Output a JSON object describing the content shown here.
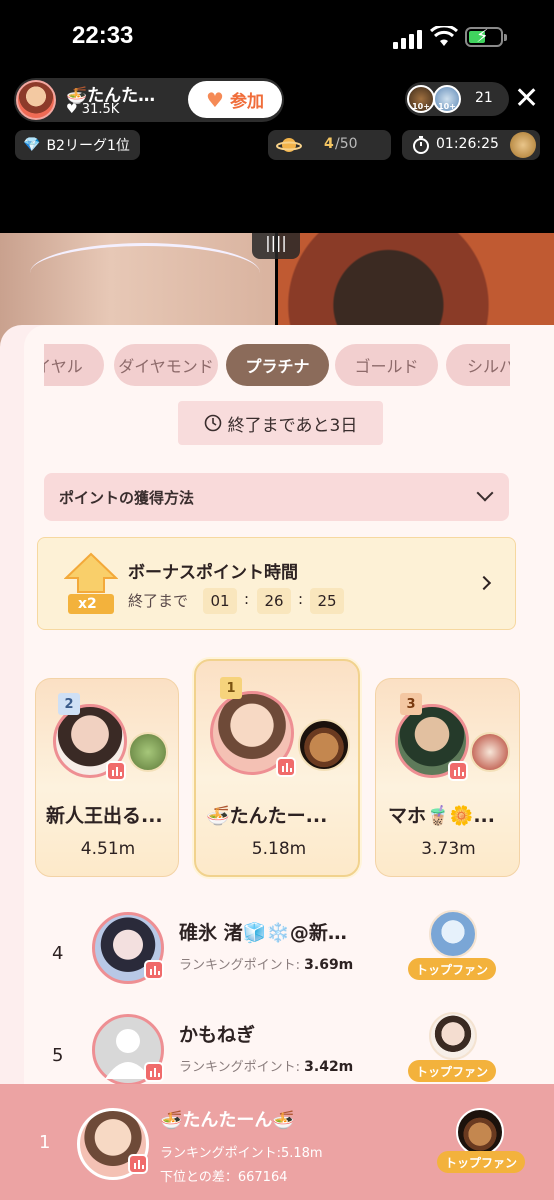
{
  "status_bar": {
    "time": "22:33"
  },
  "stream": {
    "host_name": "🍜たんた…",
    "host_likes": "31.5K",
    "join_label": "参加",
    "viewer_badges": [
      "10+",
      "10+"
    ],
    "viewer_count": "21",
    "league_label": "B2リーグ1位",
    "planet_progress_current": "4",
    "planet_progress_total": "/50",
    "session_timer": "01:26:25"
  },
  "ranking": {
    "tabs": [
      "イヤル",
      "ダイヤモンド",
      "プラチナ",
      "ゴールド",
      "シルバ"
    ],
    "active_tab": "プラチナ",
    "end_label": "終了まであと3日",
    "how_to_label": "ポイントの獲得方法",
    "bonus": {
      "badge": "x2",
      "title": "ボーナスポイント時間",
      "end_prefix": "終了まで",
      "hours": "01",
      "minutes": "26",
      "seconds": "25",
      "sep": ":"
    },
    "podium": [
      {
        "rank": "2",
        "name": "新人王出る...",
        "score": "4.51m"
      },
      {
        "rank": "1",
        "name": "🍜たんたー...",
        "score": "5.18m"
      },
      {
        "rank": "3",
        "name": "マホ🧋🌼...",
        "score": "3.73m"
      }
    ],
    "list": [
      {
        "rank": "4",
        "name": "碓氷 渚🧊❄️@新…",
        "points_label": "ランキングポイント:",
        "points": "3.69m",
        "fan_badge": "トップファン"
      },
      {
        "rank": "5",
        "name": "かもねぎ",
        "points_label": "ランキングポイント:",
        "points": "3.42m",
        "fan_badge": "トップファン"
      }
    ],
    "me": {
      "rank": "1",
      "name": "🍜たんたーん🍜",
      "points_text": "ランキングポイント:5.18m",
      "diff_text": "下位との差：667164",
      "fan_badge": "トップファン"
    }
  },
  "colors": {
    "accent": "#8b6b5a",
    "fan_badge": "#f3b23c",
    "bottom_bar": "#eca3a3"
  }
}
